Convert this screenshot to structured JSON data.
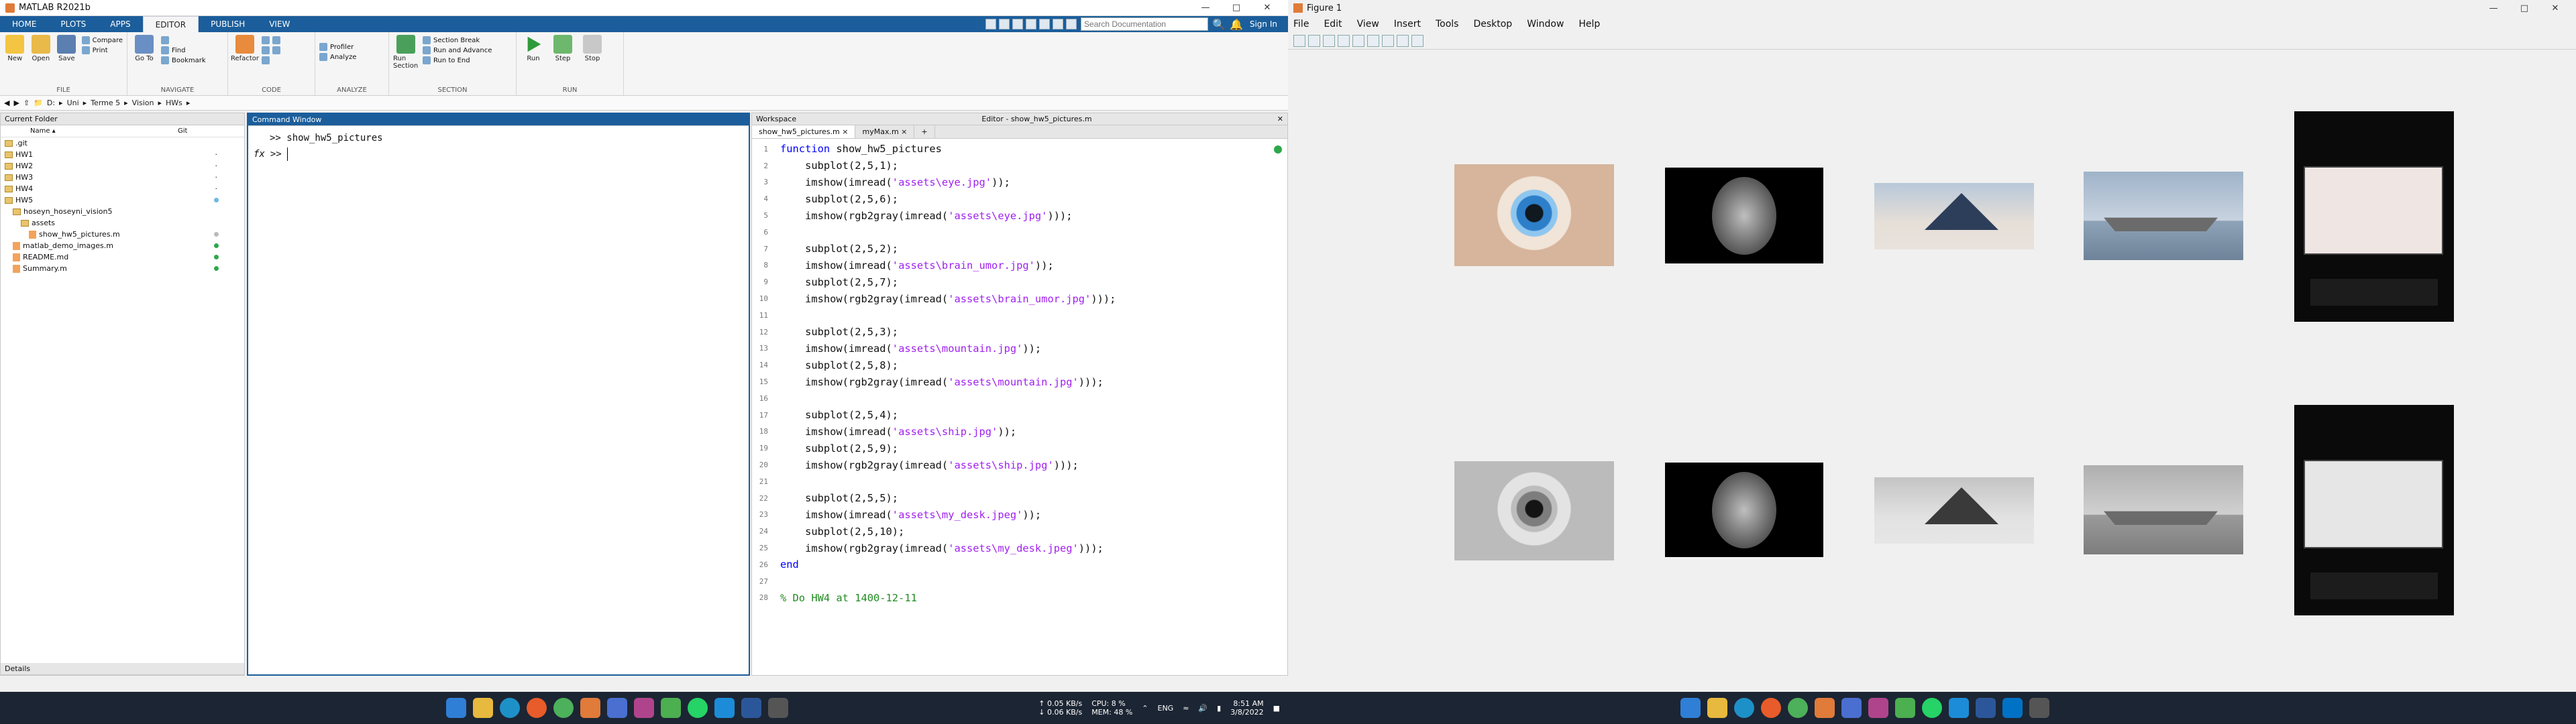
{
  "matlab": {
    "title": "MATLAB R2021b",
    "tabs": [
      "HOME",
      "PLOTS",
      "APPS",
      "EDITOR",
      "PUBLISH",
      "VIEW"
    ],
    "active_tab": "EDITOR",
    "search_placeholder": "Search Documentation",
    "sign_in": "Sign In",
    "ribbon": {
      "file": {
        "label": "FILE",
        "new": "New",
        "open": "Open",
        "save": "Save",
        "compare": "Compare",
        "print": "Print"
      },
      "navigate": {
        "label": "NAVIGATE",
        "goto": "Go To",
        "find": "Find",
        "bookmark": "Bookmark"
      },
      "code": {
        "label": "CODE",
        "refactor": "Refactor"
      },
      "analyze": {
        "label": "ANALYZE",
        "profiler": "Profiler",
        "analyze": "Analyze"
      },
      "section": {
        "label": "SECTION",
        "run_section": "Run Section",
        "section_break": "Section Break",
        "run_and_advance": "Run and Advance",
        "run_to_end": "Run to End"
      },
      "run": {
        "label": "RUN",
        "run": "Run",
        "step": "Step",
        "stop": "Stop"
      }
    },
    "path": [
      "D:",
      "Uni",
      "Terme 5",
      "Vision",
      "HWs"
    ],
    "current_folder": {
      "title": "Current Folder",
      "col_name": "Name ▴",
      "col_git": "Git",
      "items": [
        {
          "name": ".git",
          "type": "folder",
          "git": ""
        },
        {
          "name": "HW1",
          "type": "folder",
          "git": "·"
        },
        {
          "name": "HW2",
          "type": "folder",
          "git": "·"
        },
        {
          "name": "HW3",
          "type": "folder",
          "git": "·"
        },
        {
          "name": "HW4",
          "type": "folder",
          "git": "·"
        },
        {
          "name": "HW5",
          "type": "folder",
          "git": "blue"
        },
        {
          "name": "hoseyn_hoseyni_vision5",
          "type": "folder",
          "git": ""
        },
        {
          "name": "assets",
          "type": "folder",
          "git": ""
        },
        {
          "name": "show_hw5_pictures.m",
          "type": "file",
          "git": "grey"
        },
        {
          "name": "matlab_demo_images.m",
          "type": "file",
          "git": "green"
        },
        {
          "name": "README.md",
          "type": "file",
          "git": "green"
        },
        {
          "name": "Summary.m",
          "type": "file",
          "git": "green"
        }
      ],
      "details": "Details"
    },
    "command_window": {
      "title": "Command Window",
      "history": ">> show_hw5_pictures",
      "prompt": ">>",
      "fx": "fx"
    },
    "editor": {
      "workspace_label": "Workspace",
      "editor_title": "Editor - show_hw5_pictures.m",
      "tabs": [
        "show_hw5_pictures.m",
        "myMax.m"
      ],
      "lines": [
        "function show_hw5_pictures",
        "    subplot(2,5,1);",
        "    imshow(imread('assets\\eye.jpg'));",
        "    subplot(2,5,6);",
        "    imshow(rgb2gray(imread('assets\\eye.jpg')));",
        "",
        "    subplot(2,5,2);",
        "    imshow(imread('assets\\brain_umor.jpg'));",
        "    subplot(2,5,7);",
        "    imshow(rgb2gray(imread('assets\\brain_umor.jpg')));",
        "",
        "    subplot(2,5,3);",
        "    imshow(imread('assets\\mountain.jpg'));",
        "    subplot(2,5,8);",
        "    imshow(rgb2gray(imread('assets\\mountain.jpg')));",
        "",
        "    subplot(2,5,4);",
        "    imshow(imread('assets\\ship.jpg'));",
        "    subplot(2,5,9);",
        "    imshow(rgb2gray(imread('assets\\ship.jpg')));",
        "",
        "    subplot(2,5,5);",
        "    imshow(imread('assets\\my_desk.jpeg'));",
        "    subplot(2,5,10);",
        "    imshow(rgb2gray(imread('assets\\my_desk.jpeg')));",
        "end",
        "",
        "% Do HW4 at 1400-12-11"
      ]
    },
    "taskbar": {
      "net_up": "↑ 0.05 KB/s",
      "net_down": "↓ 0.06 KB/s",
      "cpu": "CPU: 8 %",
      "mem": "MEM: 48 %",
      "lang": "ENG",
      "time": "8:51 AM",
      "date": "3/8/2022"
    }
  },
  "figure": {
    "title": "Figure 1",
    "menu": [
      "File",
      "Edit",
      "View",
      "Insert",
      "Tools",
      "Desktop",
      "Window",
      "Help"
    ]
  },
  "colors": {
    "matlab_blue": "#1b5e9b",
    "taskbar": "#1c2533",
    "keyword": "#0000ff",
    "string": "#a020f0",
    "comment": "#228b22"
  }
}
